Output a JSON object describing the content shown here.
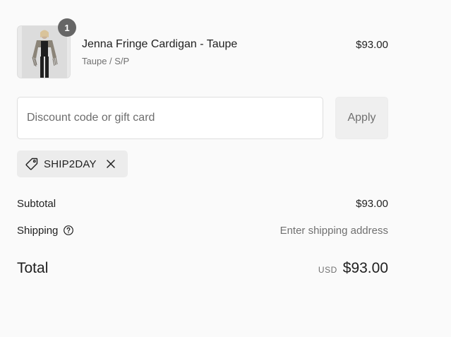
{
  "line_item": {
    "quantity": "1",
    "name": "Jenna Fringe Cardigan - Taupe",
    "variant": "Taupe / S/P",
    "price": "$93.00",
    "image_icon": "product-photo"
  },
  "discount": {
    "placeholder": "Discount code or gift card",
    "value": "",
    "apply_label": "Apply"
  },
  "applied_code": {
    "code": "SHIP2DAY",
    "icon": "tag-icon",
    "remove_icon": "close-icon"
  },
  "summary": {
    "subtotal_label": "Subtotal",
    "subtotal_value": "$93.00",
    "shipping_label": "Shipping",
    "shipping_value": "Enter shipping address",
    "shipping_help_icon": "question-circle-icon",
    "total_label": "Total",
    "currency": "USD",
    "total_value": "$93.00"
  },
  "colors": {
    "background": "#fafafa",
    "text": "#1f1f1f",
    "muted_text": "#707070",
    "badge": "#666666",
    "border": "#dedede",
    "tag_bg": "#ececec"
  }
}
